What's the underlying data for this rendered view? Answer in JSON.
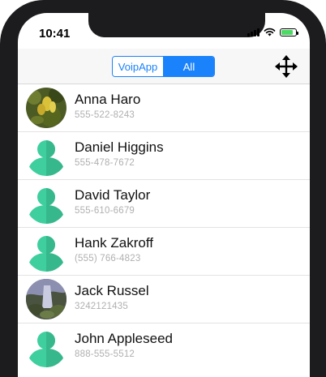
{
  "status_bar": {
    "time": "10:41"
  },
  "navbar": {
    "segments": [
      {
        "label": "VoipApp",
        "selected": false
      },
      {
        "label": "All",
        "selected": true
      }
    ],
    "move_icon": "move-arrows-icon"
  },
  "colors": {
    "accent": "#1a82fb",
    "avatar_placeholder": "#3fcf9f"
  },
  "contacts": [
    {
      "name": "Anna Haro",
      "phone": "555-522-8243",
      "avatar": "photo-flowers"
    },
    {
      "name": "Daniel Higgins",
      "phone": "555-478-7672",
      "avatar": "placeholder-person"
    },
    {
      "name": "David Taylor",
      "phone": "555-610-6679",
      "avatar": "placeholder-person"
    },
    {
      "name": "Hank Zakroff",
      "phone": "(555) 766-4823",
      "avatar": "placeholder-person"
    },
    {
      "name": "Jack Russel",
      "phone": "3242121435",
      "avatar": "photo-waterfall"
    },
    {
      "name": "John Appleseed",
      "phone": "888-555-5512",
      "avatar": "placeholder-person"
    }
  ]
}
